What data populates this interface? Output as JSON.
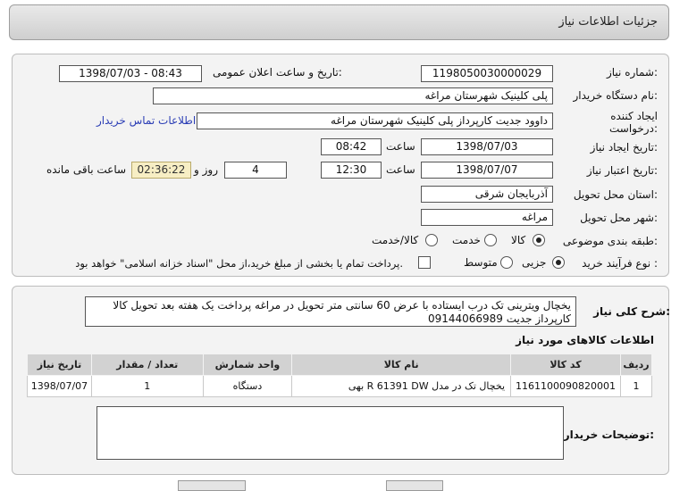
{
  "header": {
    "title": "جزئیات اطلاعات نیاز"
  },
  "form": {
    "need_number_label": "شماره نیاز:",
    "need_number": "1198050030000029",
    "announce_label": "تاریخ و ساعت اعلان عمومی:",
    "announce_value": "1398/07/03 - 08:43",
    "buyer_org_label": "نام دستگاه خریدار:",
    "buyer_org": "پلی کلینیک شهرستان مراغه",
    "creator_label": "ایجاد کننده درخواست:",
    "creator": "داوود جدیت کارپرداز پلی کلینیک شهرستان مراغه",
    "contact_link": "اطلاعات تماس خریدار",
    "created_date_label": "تاریخ ایجاد نیاز:",
    "created_date": "1398/07/03",
    "time_label": "ساعت",
    "created_time": "08:42",
    "validity_label": "تاریخ اعتبار نیاز:",
    "validity_date": "1398/07/07",
    "validity_time": "12:30",
    "days_label": "روز و",
    "days_value": "4",
    "remaining_time": "02:36:22",
    "remaining_label": "ساعت باقی مانده",
    "province_label": "استان محل تحویل:",
    "province": "آذربایجان شرقی",
    "city_label": "شهر محل تحویل:",
    "city": "مراغه",
    "category_label": "طبقه بندی موضوعی:",
    "category_options": [
      "کالا",
      "خدمت",
      "کالا/خدمت"
    ],
    "category_selected": "کالا",
    "process_label": "نوع فرآیند خرید :",
    "process_options": [
      "جزیی",
      "متوسط"
    ],
    "process_selected": "جزیی",
    "payment_note": "پرداخت تمام یا بخشی از مبلغ خرید،از محل \"اسناد خزانه اسلامی\" خواهد بود."
  },
  "summary": {
    "label": "شرح کلی نیاز:",
    "text": "یخچال ویترینی تک درب  ایستاده با عرض 60 سانتی متر تحویل در مراغه پرداخت یک هفته بعد تحویل کالا کارپرداز جدیت 09144066989"
  },
  "items_section": {
    "title": "اطلاعات کالاهای مورد نیاز",
    "columns": [
      "ردیف",
      "کد کالا",
      "نام کالا",
      "واحد شمارش",
      "تعداد / مقدار",
      "تاریخ نیاز"
    ],
    "rows": [
      [
        "1",
        "1161100090820001",
        "یخچال تک در مدل R 61391 DW بهی",
        "دستگاه",
        "1",
        "1398/07/07"
      ]
    ]
  },
  "notes": {
    "label": "توضیحات خریدار:"
  }
}
